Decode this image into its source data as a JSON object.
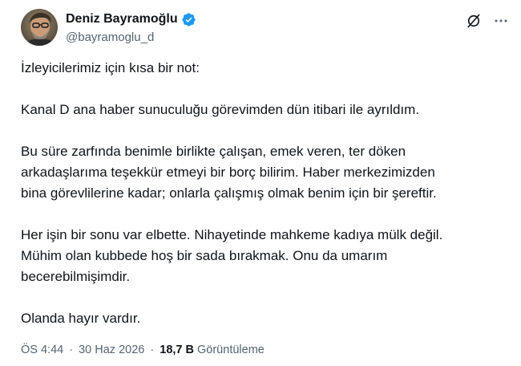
{
  "author": {
    "display_name": "Deniz Bayramoğlu",
    "handle": "@bayramoglu_d",
    "verified": true
  },
  "icons": {
    "grok": "grok-icon",
    "more": "more-options-icon",
    "verified": "verified-badge-icon"
  },
  "colors": {
    "verified_blue": "#1d9bf0",
    "secondary_text": "#536471",
    "primary_text": "#0f1419"
  },
  "tweet": {
    "paragraphs": [
      "İzleyicilerimiz için kısa bir not:",
      "Kanal D ana haber sunuculuğu görevimden dün itibari ile ayrıldım.",
      "Bu süre zarfında benimle birlikte çalışan, emek veren, ter döken\narkadaşlarıma teşekkür etmeyi bir borç bilirim. Haber merkezimizden\nbina görevlilerine kadar;  onlarla çalışmış olmak benim için bir şereftir.",
      "Her işin bir sonu var elbette. Nihayetinde mahkeme kadıya mülk değil.\nMühim olan kubbede hoş bir sada bırakmak. Onu da umarım\nbecerebilmişimdir.",
      "Olanda hayır vardır."
    ],
    "time": "ÖS 4:44",
    "date": "30 Haz 2026",
    "separator": "·",
    "views_count": "18,7 B",
    "views_label": "Görüntüleme"
  }
}
